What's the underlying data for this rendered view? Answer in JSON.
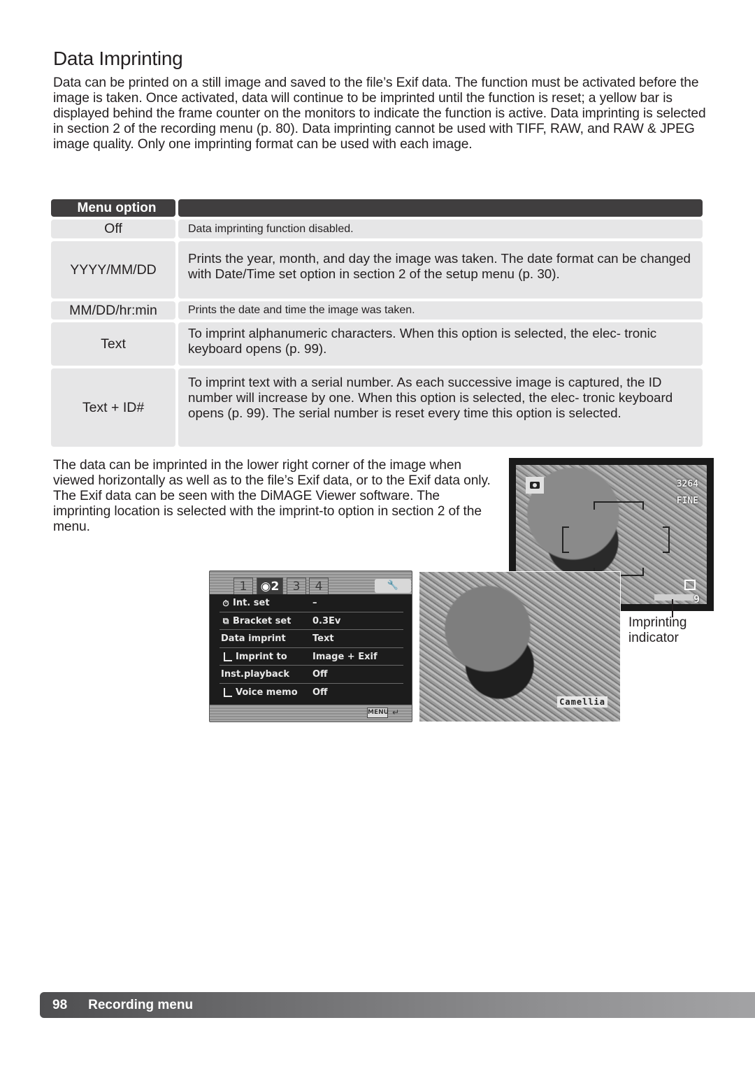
{
  "page": {
    "title": "Data Imprinting",
    "intro": "Data can be printed on a still image and saved to the file’s Exif data. The function must be activated before the image is taken. Once activated, data will continue to be imprinted until the function is reset; a yellow bar is displayed behind the frame counter on the monitors to indicate the function is active. Data imprinting is selected in section 2 of the recording menu (p. 80). Data imprinting cannot be used with TIFF, RAW, and RAW & JPEG image quality. Only one imprinting format can be used with each image.",
    "location_paragraph": "The data can be imprinted in the lower right corner of the image when viewed horizontally as well as to the file’s Exif data, or to the Exif data only. The Exif data can be seen with the DiMAGE Viewer software. The imprinting location is selected with the imprint-to option in section 2 of the menu."
  },
  "options_table": {
    "header": "Menu option",
    "rows": [
      {
        "option": "Off",
        "description": "Data imprinting function disabled."
      },
      {
        "option": "YYYY/MM/DD",
        "description": "Prints the year, month, and day the image was taken. The date format can be changed with Date/Time set option in section 2 of the setup menu (p. 30)."
      },
      {
        "option": "MM/DD/hr:min",
        "description": "Prints the date and time the image was taken."
      },
      {
        "option": "Text",
        "description": "To imprint alphanumeric characters. When this option is selected, the elec- tronic keyboard opens (p. 99)."
      },
      {
        "option": "Text + ID#",
        "description": "To imprint text with a serial number. As each successive image is captured, the ID number will increase by one. When this option is selected, the elec- tronic keyboard opens (p. 99). The serial number is reset every time this option is selected."
      }
    ]
  },
  "camera_menu": {
    "tabs": [
      "1",
      "2",
      "3",
      "4"
    ],
    "active_tab": "2",
    "setup_tab_icon": "wrench-icon",
    "items": [
      {
        "label": "Int. set",
        "value": "–",
        "icon": "interval-timer-icon"
      },
      {
        "label": "Bracket set",
        "value": "0.3Ev",
        "icon": "bracket-icon"
      },
      {
        "label": "Data imprint",
        "value": "Text"
      },
      {
        "label": "Imprint to",
        "value": "Image + Exif",
        "sub": true
      },
      {
        "label": "Inst.playback",
        "value": "Off"
      },
      {
        "label": "Voice memo",
        "value": "Off",
        "sub": true
      }
    ],
    "menu_button": "MENU"
  },
  "monitor": {
    "frame_count": "3264",
    "quality": "FINE",
    "frames_remaining": "9"
  },
  "playback": {
    "imprint_text": "Camellia"
  },
  "callout": {
    "line1": "Imprinting",
    "line2": "indicator"
  },
  "footer": {
    "page_number": "98",
    "section": "Recording menu"
  }
}
